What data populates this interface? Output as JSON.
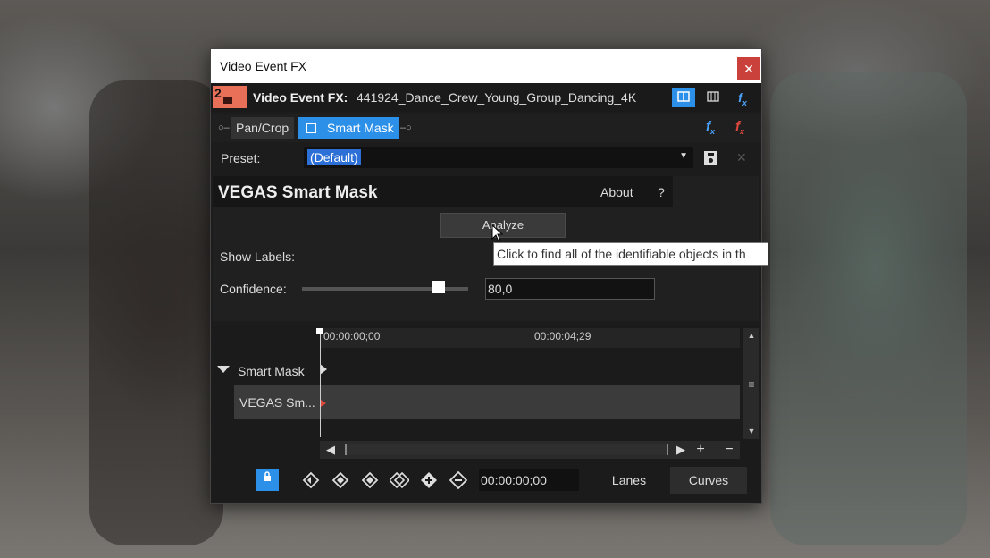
{
  "window": {
    "title": "Video Event FX"
  },
  "header": {
    "badge": "2",
    "label": "Video Event FX:",
    "file_name": "441924_Dance_Crew_Young_Group_Dancing_4K"
  },
  "chain": {
    "items": [
      {
        "label": "Pan/Crop"
      },
      {
        "label": "Smart Mask"
      }
    ]
  },
  "preset": {
    "label": "Preset:",
    "value": "(Default)"
  },
  "plugin": {
    "name": "VEGAS Smart Mask",
    "about": "About",
    "help": "?",
    "analyze_label": "Analyze",
    "show_labels_label": "Show Labels:",
    "confidence_label": "Confidence:",
    "confidence_value": "80,0",
    "confidence_level": 0.82
  },
  "tooltip": {
    "text": "Click to find all of the identifiable objects in th"
  },
  "timeline": {
    "time_start": "00:00:00;00",
    "time_mid": "00:00:04;29",
    "track_label": "Smart Mask",
    "sub_track_label": "VEGAS Sm..."
  },
  "footer": {
    "timecode": "00:00:00;00",
    "lanes": "Lanes",
    "curves": "Curves"
  },
  "colors": {
    "accent": "#2c8fe8",
    "close": "#c9413a",
    "fx_red": "#e0483c"
  },
  "icons": [
    "lock-icon",
    "prev-keyframe-icon",
    "first-keyframe-icon",
    "add-keyframe-icon",
    "delete-keyframe-icon",
    "next-keyframe-icon",
    "last-keyframe-icon"
  ]
}
